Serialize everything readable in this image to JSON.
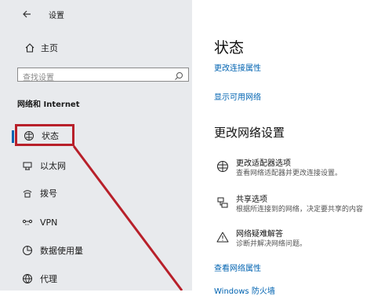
{
  "nav": {
    "back_icon": "back-arrow-icon",
    "title": "设置"
  },
  "sidebar": {
    "home_label": "主页",
    "search_placeholder": "查找设置",
    "section_title": "网络和 Internet",
    "items": [
      {
        "label": "状态",
        "icon": "status-icon"
      },
      {
        "label": "以太网",
        "icon": "ethernet-icon"
      },
      {
        "label": "拨号",
        "icon": "dialup-icon"
      },
      {
        "label": "VPN",
        "icon": "vpn-icon"
      },
      {
        "label": "数据使用量",
        "icon": "data-usage-icon"
      },
      {
        "label": "代理",
        "icon": "proxy-icon"
      }
    ]
  },
  "main": {
    "title": "状态",
    "change_connection_properties": "更改连接属性",
    "show_available_networks": "显示可用网络",
    "section_title": "更改网络设置",
    "options": [
      {
        "title": "更改适配器选项",
        "desc": "查看网络适配器并更改连接设置。",
        "icon": "adapter-icon"
      },
      {
        "title": "共享选项",
        "desc": "根据所连接到的网络，决定要共享的内容",
        "icon": "sharing-icon"
      },
      {
        "title": "网络疑难解答",
        "desc": "诊断并解决网络问题。",
        "icon": "warning-icon"
      }
    ],
    "view_network_properties": "查看网络属性",
    "windows_firewall": "Windows 防火墙"
  },
  "colors": {
    "accent": "#0063b1",
    "highlight_border": "#b8202a",
    "sidebar_bg": "#e8eaed"
  }
}
